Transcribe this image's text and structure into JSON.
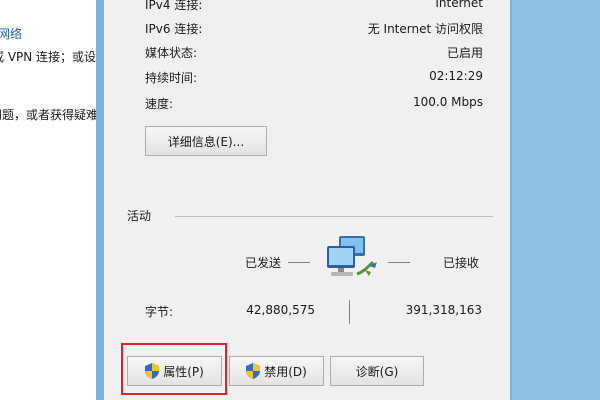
{
  "background_window": {
    "lines": [
      {
        "text": "网络",
        "link": true
      },
      {
        "text": "或 VPN 连接；或设",
        "link": false
      },
      {
        "text": "问题，或者获得疑难",
        "link": false
      }
    ]
  },
  "connection": {
    "rows": [
      {
        "label": "IPv4 连接:",
        "value": "Internet"
      },
      {
        "label": "IPv6 连接:",
        "value": "无 Internet 访问权限"
      },
      {
        "label": "媒体状态:",
        "value": "已启用"
      },
      {
        "label": "持续时间:",
        "value": "02:12:29"
      },
      {
        "label": "速度:",
        "value": "100.0 Mbps"
      }
    ],
    "details_button": "详细信息(E)..."
  },
  "activity": {
    "title": "活动",
    "sent_label": "已发送",
    "received_label": "已接收",
    "bytes_label": "字节:",
    "bytes_sent": "42,880,575",
    "bytes_received": "391,318,163"
  },
  "buttons": {
    "properties": "属性(P)",
    "disable": "禁用(D)",
    "diagnose": "诊断(G)"
  },
  "colors": {
    "highlight": "#e0202a",
    "link": "#1f5fbf",
    "frame": "#7ab4dd"
  }
}
